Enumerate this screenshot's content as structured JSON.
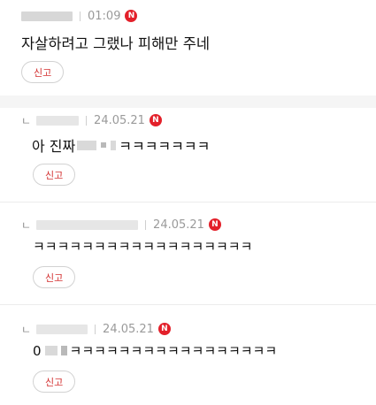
{
  "comments": [
    {
      "time": "01:09",
      "badge": "N",
      "text": "자살하려고 그랬나 피해만 주네",
      "report_label": "신고"
    },
    {
      "reply_marker": "ㄴ",
      "time": "24.05.21",
      "badge": "N",
      "text_prefix": "아 진짜",
      "text_suffix": "ㅋㅋㅋㅋㅋㅋㅋ",
      "report_label": "신고"
    },
    {
      "reply_marker": "ㄴ",
      "time": "24.05.21",
      "badge": "N",
      "text": "ㅋㅋㅋㅋㅋㅋㅋㅋㅋㅋㅋㅋㅋㅋㅋㅋㅋㅋ",
      "report_label": "신고"
    },
    {
      "reply_marker": "ㄴ",
      "time": "24.05.21",
      "badge": "N",
      "text_prefix": "0",
      "text_suffix": "ㅋㅋㅋㅋㅋㅋㅋㅋㅋㅋㅋㅋㅋㅋㅋㅋㅋ",
      "report_label": "신고"
    }
  ],
  "colors": {
    "badge": "#e3202a",
    "report_text": "#d32f2f",
    "meta_text": "#9a9a9a"
  }
}
